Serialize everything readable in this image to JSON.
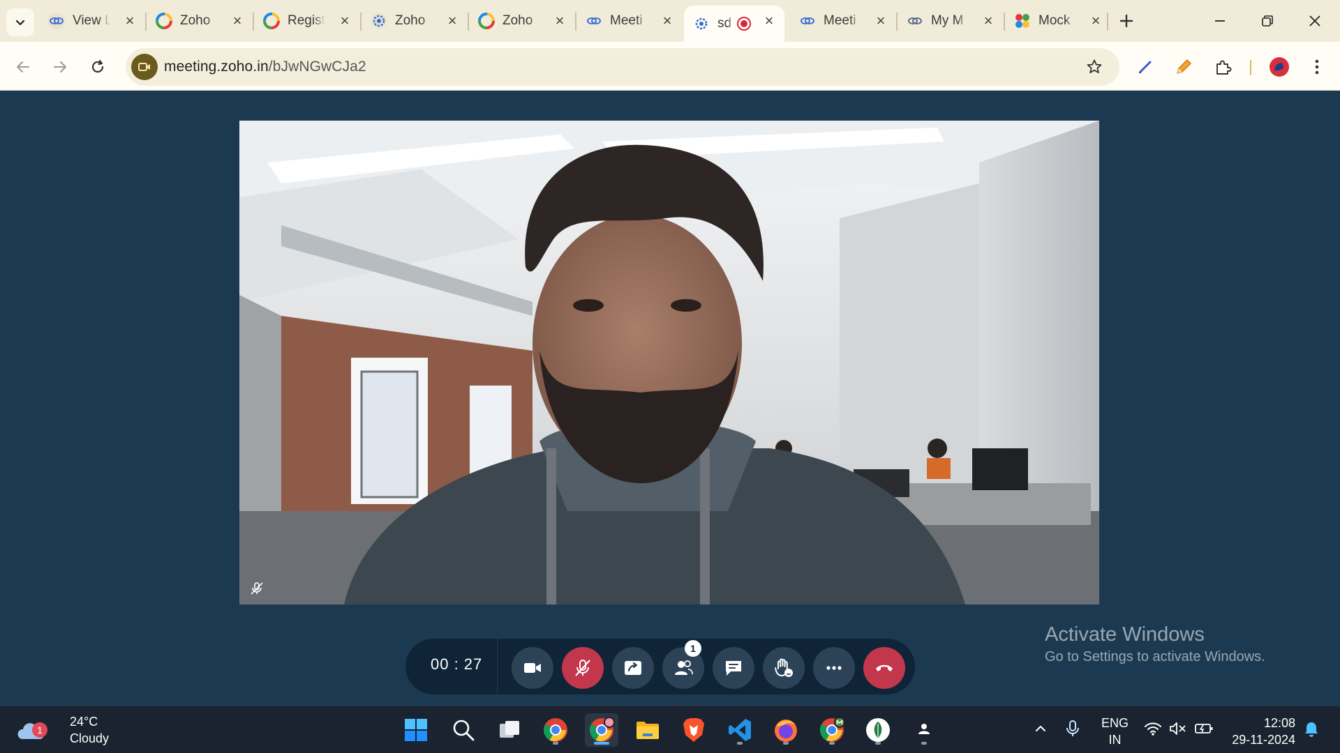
{
  "browser": {
    "tabs": [
      {
        "title": "View L",
        "icon": "meeting-link-icon"
      },
      {
        "title": "Zoho",
        "icon": "zoho-ring-icon"
      },
      {
        "title": "Regist",
        "icon": "zoho-ring-icon"
      },
      {
        "title": "Zoho",
        "icon": "zoho-gear-icon"
      },
      {
        "title": "Zoho",
        "icon": "zoho-ring-icon"
      },
      {
        "title": "Meeti",
        "icon": "meeting-link-icon"
      },
      {
        "title": "sd",
        "icon": "zoho-gear-icon",
        "active": true,
        "recording": true
      },
      {
        "title": "Meeti",
        "icon": "meeting-link-icon"
      },
      {
        "title": "My M",
        "icon": "meeting-link-icon"
      },
      {
        "title": "Mock",
        "icon": "colorful-gear-icon"
      }
    ],
    "url_host": "meeting.zoho.in",
    "url_path": "/bJwNGwCJa2"
  },
  "meeting": {
    "timer": "00 : 27",
    "participants_count": "1",
    "controls": [
      "video",
      "mute",
      "share-screen",
      "participants",
      "chat",
      "raise-hand",
      "more",
      "end-call"
    ]
  },
  "watermark": {
    "title": "Activate Windows",
    "subtitle": "Go to Settings to activate Windows."
  },
  "taskbar": {
    "weather_badge": "1",
    "temperature": "24°C",
    "condition": "Cloudy",
    "language_top": "ENG",
    "language_bottom": "IN",
    "time": "12:08",
    "date": "29-11-2024"
  },
  "colors": {
    "tab_strip": "#f1ecd9",
    "meeting_bg": "#1b3a52",
    "controls_bg": "#0f2436",
    "mute_red": "#c2374c",
    "taskbar": "#1b2330"
  }
}
